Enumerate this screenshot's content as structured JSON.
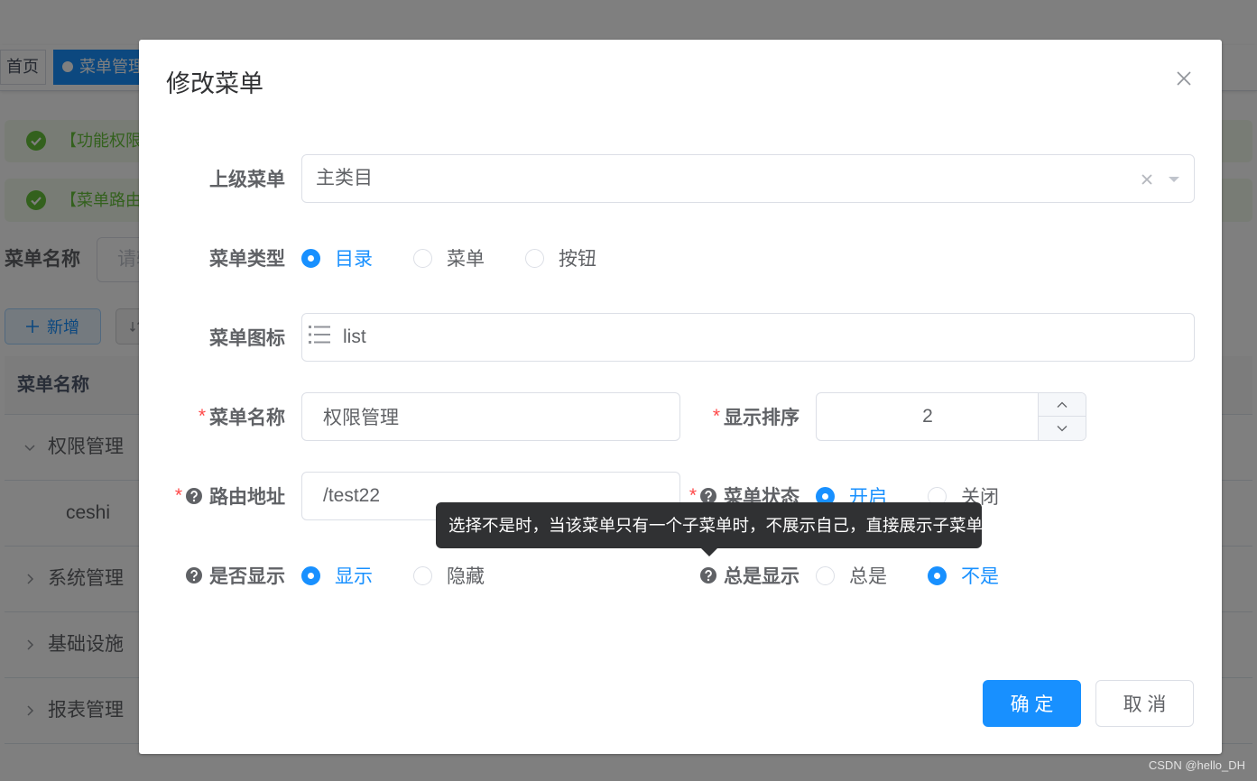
{
  "colors": {
    "primary": "#1890ff",
    "required": "#ff4949",
    "tooltip_bg": "#303133",
    "success": "#67c23a",
    "overlay": "rgba(0,0,0,0.5)"
  },
  "tags_view": {
    "tags": [
      {
        "label": "首页"
      },
      {
        "label": "菜单管理",
        "active": true
      }
    ]
  },
  "alerts": [
    {
      "text": "【功能权限",
      "icon": "check-circle-icon"
    },
    {
      "text": "【菜单路由",
      "icon": "check-circle-icon"
    }
  ],
  "search": {
    "label": "菜单名称",
    "placeholder": "请输"
  },
  "toolbar": {
    "add_label": "新增",
    "add_icon": "plus-icon"
  },
  "table": {
    "header": "菜单名称",
    "rows": [
      {
        "name": "权限管理",
        "expanded": true
      },
      {
        "name": "ceshi",
        "level": 1
      },
      {
        "name": "系统管理",
        "expanded": false
      },
      {
        "name": "基础设施",
        "expanded": false
      },
      {
        "name": "报表管理",
        "expanded": false
      }
    ]
  },
  "dialog": {
    "title": "修改菜单",
    "close_icon": "close-icon",
    "required_mark": "*",
    "form": {
      "parent_menu": {
        "label": "上级菜单",
        "value": "主类目",
        "icons": [
          "clear-icon",
          "caret-down-icon"
        ]
      },
      "menu_type": {
        "label": "菜单类型",
        "options": [
          "目录",
          "菜单",
          "按钮"
        ],
        "selected": "目录"
      },
      "menu_icon": {
        "label": "菜单图标",
        "value": "list",
        "icon": "list-icon"
      },
      "menu_name": {
        "label": "菜单名称",
        "value": "权限管理"
      },
      "order_num": {
        "label": "显示排序",
        "value": 2
      },
      "path": {
        "label": "路由地址",
        "value": "/test22"
      },
      "status": {
        "label": "菜单状态",
        "options": [
          "开启",
          "关闭"
        ],
        "selected": "开启"
      },
      "visible": {
        "label": "是否显示",
        "options": [
          "显示",
          "隐藏"
        ],
        "selected": "显示"
      },
      "always_show": {
        "label": "总是显示",
        "options": [
          "总是",
          "不是"
        ],
        "selected": "不是"
      }
    },
    "tooltip": "选择不是时，当该菜单只有一个子菜单时，不展示自己，直接展示子菜单",
    "buttons": {
      "confirm": "确 定",
      "cancel": "取 消"
    }
  },
  "watermark": "CSDN @hello_DH"
}
